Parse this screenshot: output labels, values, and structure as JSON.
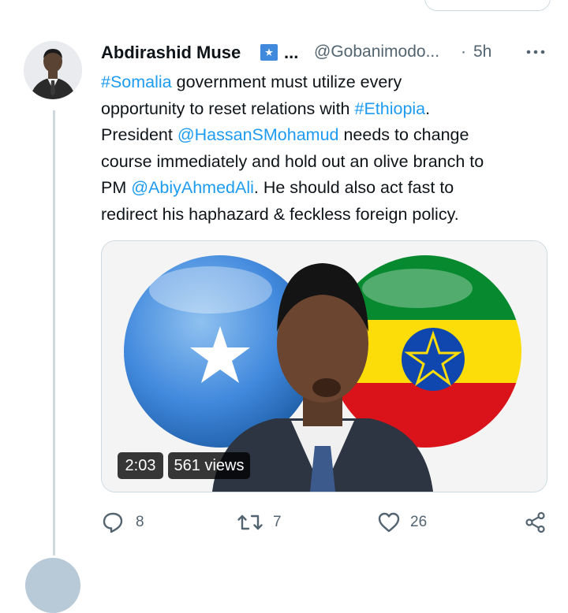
{
  "tweet": {
    "author_name": "Abdirashid Muse",
    "name_ellipsis": "...",
    "handle": "@Gobanimodo...",
    "separator": "·",
    "time": "5h",
    "text_lines": [
      [
        {
          "t": "#Somalia",
          "link": true
        },
        {
          "t": " government must utilize every",
          "link": false
        }
      ],
      [
        {
          "t": "opportunity to reset relations with ",
          "link": false
        },
        {
          "t": "#Ethiopia",
          "link": true
        },
        {
          "t": ".",
          "link": false
        }
      ],
      [
        {
          "t": "President ",
          "link": false
        },
        {
          "t": "@HassanSMohamud",
          "link": true
        },
        {
          "t": " needs to change",
          "link": false
        }
      ],
      [
        {
          "t": "course immediately and hold out an olive branch to",
          "link": false
        }
      ],
      [
        {
          "t": "PM ",
          "link": false
        },
        {
          "t": "@AbiyAhmedAli",
          "link": true
        },
        {
          "t": ". He should also act fast to",
          "link": false
        }
      ],
      [
        {
          "t": "redirect his haphazard & feckless foreign policy.",
          "link": false
        }
      ]
    ],
    "video": {
      "duration": "2:03",
      "views": "561 views"
    },
    "actions": {
      "replies": "8",
      "retweets": "7",
      "likes": "26"
    }
  },
  "colors": {
    "link": "#1d9bf0",
    "muted": "#536471",
    "text": "#0f1419",
    "somalia_blue": "#4189dd",
    "ethiopia_green": "#078930",
    "ethiopia_yellow": "#fcdd09",
    "ethiopia_red": "#da121a"
  },
  "icons": {
    "flag": "somalia-flag-icon",
    "more": "more-dots-icon",
    "reply": "reply-icon",
    "retweet": "retweet-icon",
    "like": "heart-icon",
    "share": "share-icon"
  }
}
